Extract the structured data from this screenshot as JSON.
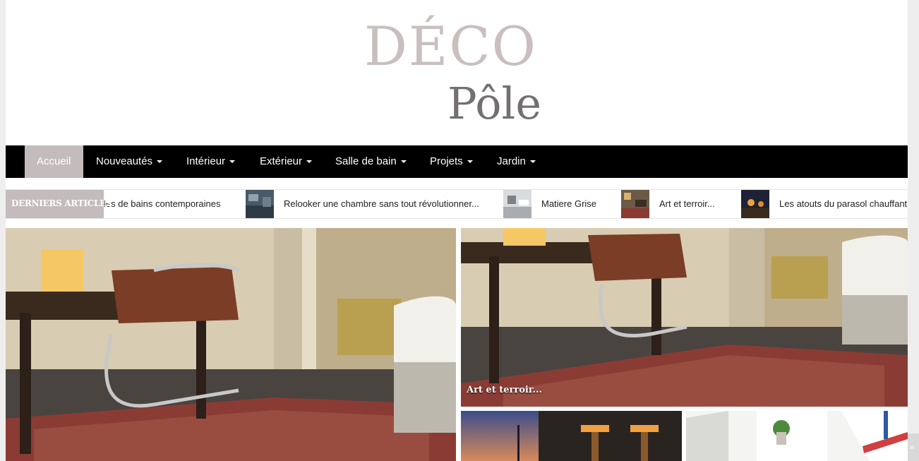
{
  "logo": {
    "line1": "DÉCO",
    "line2": "Pôle"
  },
  "nav": {
    "items": [
      {
        "label": "Accueil",
        "active": true,
        "dropdown": false
      },
      {
        "label": "Nouveautés",
        "dropdown": true
      },
      {
        "label": "Intérieur",
        "dropdown": true
      },
      {
        "label": "Extérieur",
        "dropdown": true
      },
      {
        "label": "Salle de bain",
        "dropdown": true
      },
      {
        "label": "Projets",
        "dropdown": true
      },
      {
        "label": "Jardin",
        "dropdown": true
      }
    ]
  },
  "ticker": {
    "label": "DERNIERS ARTICLES",
    "items": [
      {
        "title": "les de bains contemporaines"
      },
      {
        "title": "Relooker une chambre sans tout révolutionner..."
      },
      {
        "title": "Matiere Grise"
      },
      {
        "title": "Art et terroir..."
      },
      {
        "title": "Les atouts du parasol chauffant"
      }
    ]
  },
  "featured": {
    "top_right_caption": "Art et terroir..."
  },
  "colors": {
    "accent": "#c4bcbc",
    "nav_bg": "#000000",
    "logo_light": "#c9bfbf",
    "logo_dark": "#757070"
  },
  "icons": {
    "scroll_top": "chevron-up-icon"
  }
}
